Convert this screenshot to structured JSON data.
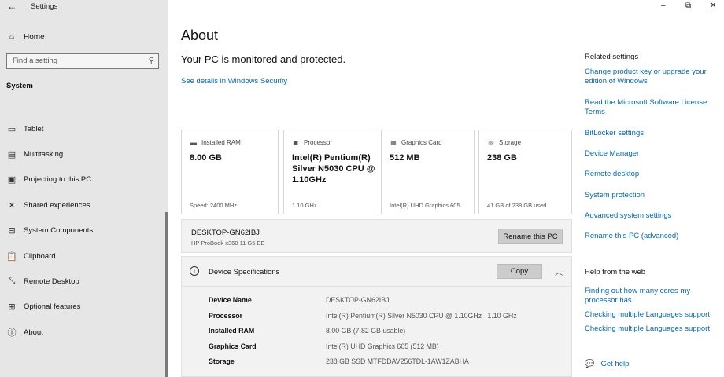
{
  "window": {
    "app_title": "Settings",
    "controls": {
      "minimize": "–",
      "restore": "⧉",
      "close": "✕"
    }
  },
  "sidebar": {
    "home_label": "Home",
    "search_placeholder": "Find a setting",
    "section": "System",
    "items": [
      {
        "label": "Tablet",
        "icon": "tablet-icon"
      },
      {
        "label": "Multitasking",
        "icon": "multitasking-icon"
      },
      {
        "label": "Projecting to this PC",
        "icon": "projecting-icon"
      },
      {
        "label": "Shared experiences",
        "icon": "shared-experiences-icon"
      },
      {
        "label": "System Components",
        "icon": "system-components-icon"
      },
      {
        "label": "Clipboard",
        "icon": "clipboard-icon"
      },
      {
        "label": "Remote Desktop",
        "icon": "remote-desktop-icon"
      },
      {
        "label": "Optional features",
        "icon": "optional-features-icon"
      },
      {
        "label": "About",
        "icon": "info-icon"
      }
    ]
  },
  "main": {
    "title": "About",
    "protect_text": "Your PC is monitored and protected.",
    "security_link": "See details in Windows Security",
    "cards": [
      {
        "label": "Installed RAM",
        "value": "8.00 GB",
        "sub": "Speed: 2400 MHz",
        "icon": "ram-icon"
      },
      {
        "label": "Processor",
        "value": "Intel(R) Pentium(R) Silver N5030 CPU @ 1.10GHz",
        "sub": "1.10 GHz",
        "icon": "processor-icon"
      },
      {
        "label": "Graphics Card",
        "value": "512 MB",
        "sub": "Intel(R) UHD Graphics 605",
        "icon": "graphics-card-icon"
      },
      {
        "label": "Storage",
        "value": "238 GB",
        "sub": "41 GB of 238 GB used",
        "icon": "storage-icon"
      }
    ],
    "device": {
      "name": "DESKTOP-GN62IBJ",
      "model": "HP ProBook x360 11 G5 EE",
      "rename_label": "Rename this PC"
    },
    "specs": {
      "title": "Device Specifications",
      "copy_label": "Copy",
      "rows": [
        {
          "key": "Device Name",
          "value": "DESKTOP-GN62IBJ"
        },
        {
          "key": "Processor",
          "value": "Intel(R) Pentium(R) Silver N5030 CPU @ 1.10GHz   1.10 GHz"
        },
        {
          "key": "Installed RAM",
          "value": "8.00 GB (7.82 GB usable)"
        },
        {
          "key": "Graphics Card",
          "value": "Intel(R) UHD Graphics 605 (512 MB)"
        },
        {
          "key": "Storage",
          "value": "238 GB SSD MTFDDAV256TDL-1AW1ZABHA"
        }
      ]
    }
  },
  "right": {
    "related_head": "Related settings",
    "related_links": [
      "Change product key or upgrade your edition of Windows",
      "Read the Microsoft Software License Terms",
      "BitLocker settings",
      "Device Manager",
      "Remote desktop",
      "System protection",
      "Advanced system settings",
      "Rename this PC (advanced)"
    ],
    "help_head": "Help from the web",
    "help_links": [
      "Finding out how many cores my processor has",
      "Checking multiple Languages support",
      "Checking multiple Languages support"
    ],
    "get_help": "Get help"
  },
  "colors": {
    "accent": "#0067b8",
    "sidebar_bg": "#e6e6e6",
    "panel_bg": "#f2f2f2"
  }
}
